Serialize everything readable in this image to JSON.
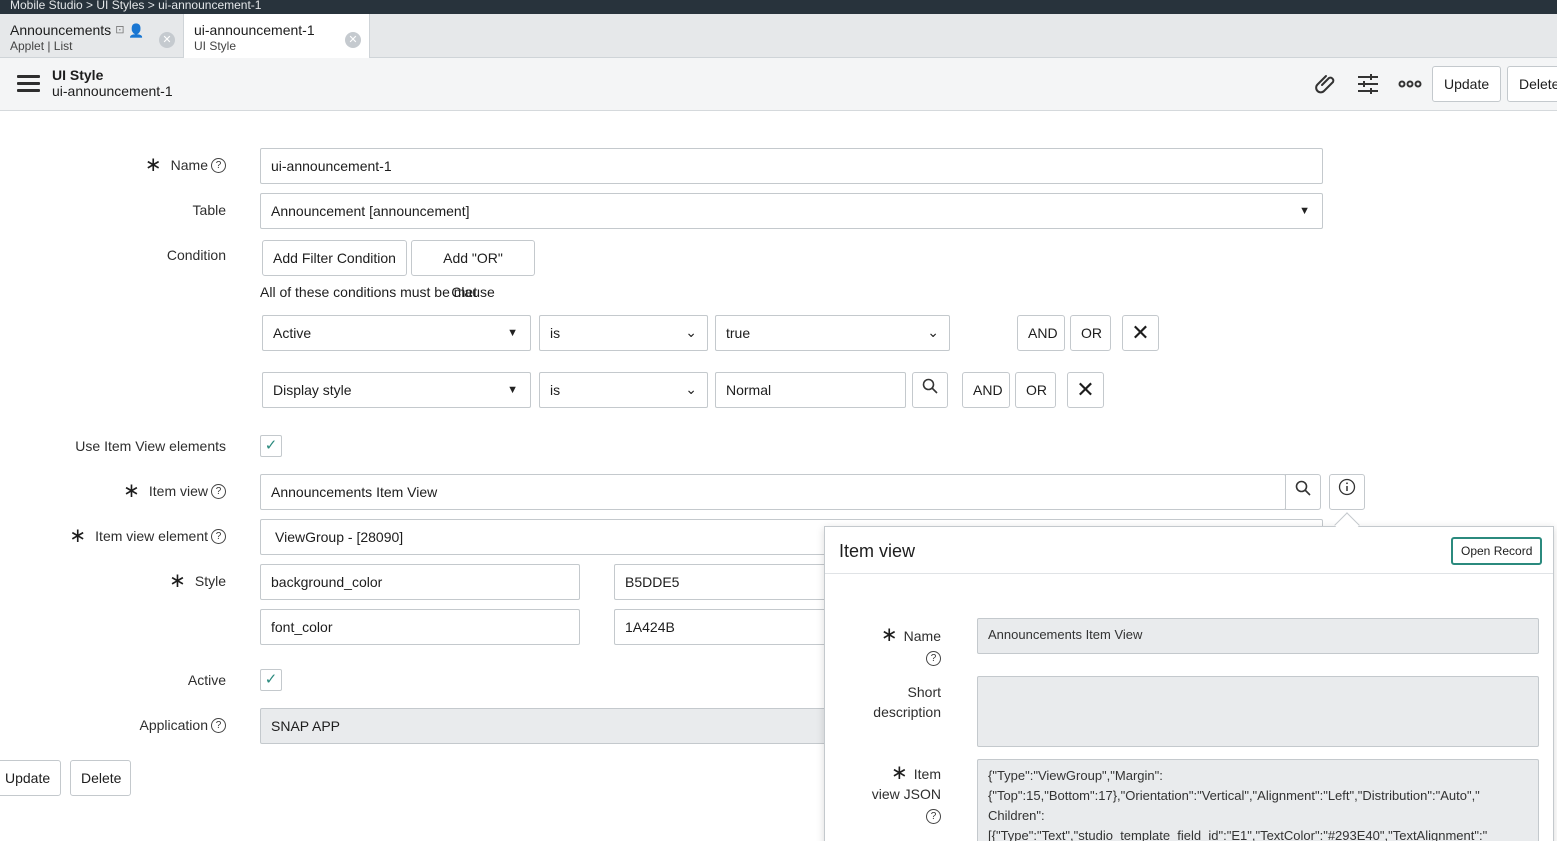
{
  "breadcrumb": "Mobile Studio > UI Styles > ui-announcement-1",
  "tabs": [
    {
      "title": "Announcements",
      "subtitle": "Applet | List"
    },
    {
      "title": "ui-announcement-1",
      "subtitle": "UI Style"
    }
  ],
  "header": {
    "record_type": "UI Style",
    "record_name": "ui-announcement-1",
    "update_label": "Update",
    "delete_label": "Delete"
  },
  "form": {
    "name_label": "Name",
    "name_value": "ui-announcement-1",
    "table_label": "Table",
    "table_value": "Announcement [announcement]",
    "condition_label": "Condition",
    "add_filter_label": "Add Filter Condition",
    "add_or_label": "Add \"OR\" Clause",
    "conditions_text": "All of these conditions must be met",
    "conditions": [
      {
        "field": "Active",
        "operator": "is",
        "value": "true"
      },
      {
        "field": "Display style",
        "operator": "is",
        "value": "Normal"
      }
    ],
    "and_label": "AND",
    "or_label": "OR",
    "use_item_view_label": "Use Item View elements",
    "item_view_label": "Item view",
    "item_view_value": "Announcements Item View",
    "item_view_element_label": "Item view element",
    "item_view_element_value": "ViewGroup - [28090]",
    "style_label": "Style",
    "styles": [
      {
        "key": "background_color",
        "value": "B5DDE5"
      },
      {
        "key": "font_color",
        "value": "1A424B"
      }
    ],
    "active_label": "Active",
    "application_label": "Application",
    "application_value": "SNAP APP",
    "update_label": "Update",
    "delete_label": "Delete"
  },
  "popover": {
    "title": "Item view",
    "open_record_label": "Open Record",
    "name_label": "Name",
    "name_value": "Announcements Item View",
    "short_desc_label_1": "Short",
    "short_desc_label_2": "description",
    "json_label_1": "Item",
    "json_label_2": "view JSON",
    "json_line_1": "{\"Type\":\"ViewGroup\",\"Margin\":",
    "json_line_2": "{\"Top\":15,\"Bottom\":17},\"Orientation\":\"Vertical\",\"Alignment\":\"Left\",\"Distribution\":\"Auto\",\"",
    "json_line_3": "Children\":",
    "json_line_4": "[{\"Type\":\"Text\",\"studio_template_field_id\":\"E1\",\"TextColor\":\"#293E40\",\"TextAlignment\":\""
  },
  "colors": {
    "accent": "#2b8a7e",
    "topbar": "#28333c",
    "header_bg": "#f4f5f6"
  }
}
